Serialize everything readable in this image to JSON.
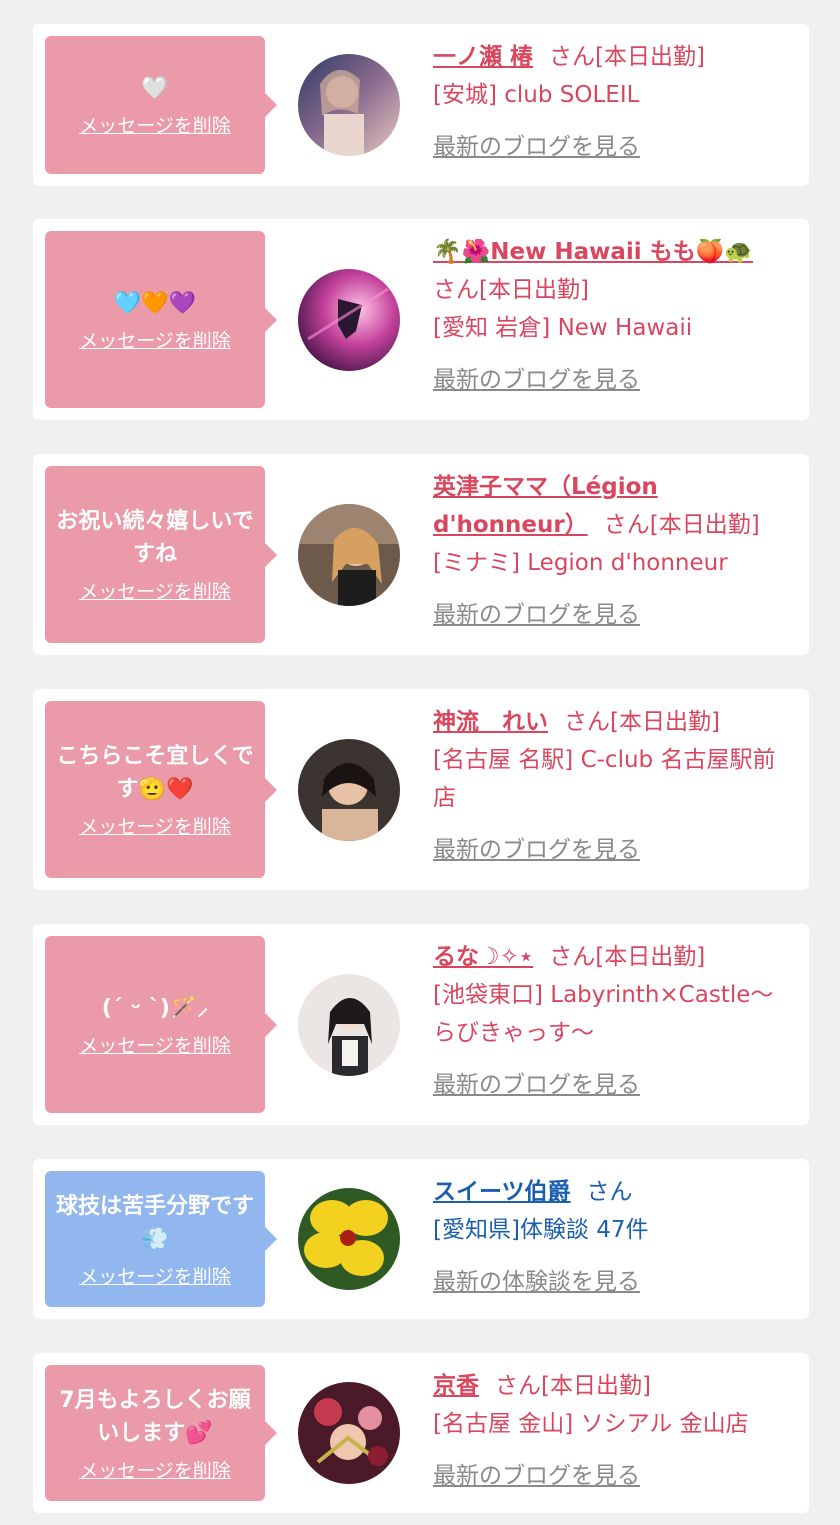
{
  "delete_label": "メッセージを削除",
  "colors": {
    "pink_bubble": "#ea9aa8",
    "blue_bubble": "#92b6ee",
    "pink_text": "#d9475f",
    "blue_text": "#1b5fae",
    "link_gray": "#8a8a8a"
  },
  "items": [
    {
      "message": "🤍",
      "name": "一ノ瀬 椿",
      "suffix": "さん[本日出勤]",
      "shop": "[安城] club SOLEIL",
      "link": "最新のブログを見る",
      "theme": "pink",
      "avatar_icon": "avatar-photo"
    },
    {
      "message": "🩵🧡💜",
      "name": "🌴🌺New Hawaii もも🍑🐢",
      "suffix": "さん[本日出勤]",
      "shop": "[愛知 岩倉] New Hawaii",
      "link": "最新のブログを見る",
      "theme": "pink",
      "avatar_icon": "avatar-photo"
    },
    {
      "message": "お祝い続々嬉しいですね",
      "name": "英津子ママ（Légion d'honneur）",
      "suffix": "さん[本日出勤]",
      "shop": "[ミナミ] Legion d'honneur",
      "link": "最新のブログを見る",
      "theme": "pink",
      "avatar_icon": "avatar-photo"
    },
    {
      "message": "こちらこそ宜しくです🫡❤️",
      "name": "神流　れい",
      "suffix": "さん[本日出勤]",
      "shop": "[名古屋 名駅] C-club 名古屋駅前店",
      "link": "最新のブログを見る",
      "theme": "pink",
      "avatar_icon": "avatar-photo"
    },
    {
      "message": "(ˊ ᵕ ˋ)🪄⸝",
      "name": "るな☽✧⋆",
      "suffix": "さん[本日出勤]",
      "shop": "[池袋東口] Labyrinth×Castle〜らびきゃっす〜",
      "link": "最新のブログを見る",
      "theme": "pink",
      "avatar_icon": "avatar-photo"
    },
    {
      "message": "球技は苦手分野です💨",
      "name": "スイーツ伯爵",
      "suffix": "さん",
      "shop": "[愛知県]体験談 47件",
      "link": "最新の体験談を見る",
      "theme": "blue",
      "avatar_icon": "hibiscus-avatar"
    },
    {
      "message": "7月もよろしくお願いします💕",
      "name": "京香",
      "suffix": "さん[本日出勤]",
      "shop": "[名古屋 金山] ソシアル 金山店",
      "link": "最新のブログを見る",
      "theme": "pink",
      "avatar_icon": "avatar-photo"
    }
  ]
}
